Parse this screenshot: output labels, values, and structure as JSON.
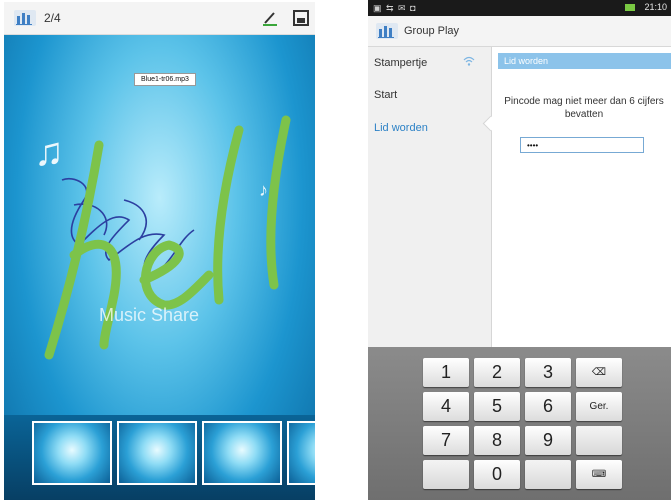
{
  "left_screen": {
    "page_indicator": "2/4",
    "filename_label": "Blue1-tr06.mp3",
    "caption": "Music Share",
    "handwriting": "hell",
    "thumbnail_count": 4,
    "icons": [
      "group-play-icon",
      "pen-icon",
      "save-icon",
      "music-note-icon"
    ]
  },
  "right_screen": {
    "status_bar": {
      "left_icons": "▣ ⇆ ✉ ◘",
      "clock": "21:10"
    },
    "app_title": "Group Play",
    "menu": [
      {
        "label": "Stampertje",
        "selected": false
      },
      {
        "label": "Start",
        "selected": false
      },
      {
        "label": "Lid worden",
        "selected": true
      }
    ],
    "panel": {
      "header": "Lid worden",
      "message": "Pincode mag niet meer dan 6 cijfers bevatten",
      "pin_value": "••••"
    },
    "keypad": {
      "keys": [
        "1",
        "2",
        "3",
        "⌫",
        "4",
        "5",
        "6",
        "Ger.",
        "7",
        "8",
        "9",
        "",
        "",
        "0",
        "",
        "⌨"
      ]
    }
  },
  "colors": {
    "accent_blue": "#2d82c6",
    "panel_header": "#8cc3ea",
    "green_stroke": "#7dc34a",
    "scribble_blue": "#2c3fa0"
  }
}
